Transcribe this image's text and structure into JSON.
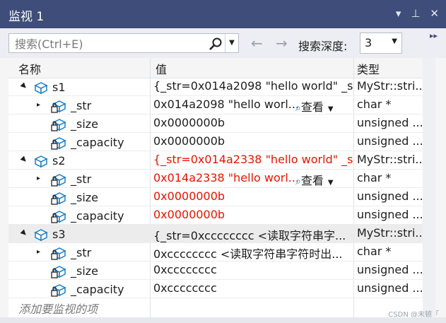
{
  "window": {
    "title": "监视 1",
    "icons": [
      "pin-dropdown-icon",
      "pin-icon",
      "close-icon"
    ]
  },
  "toolbar": {
    "search_placeholder": "搜索(Ctrl+E)",
    "depth_label": "搜索深度:",
    "depth_value": "3"
  },
  "columns": {
    "name": "名称",
    "value": "值",
    "type": "类型"
  },
  "rows": [
    {
      "name": "s1",
      "value": "{_str=0x014a2098 \"hello world\" _s...",
      "type": "MyStr::stri...",
      "level": 0,
      "expander": "▲",
      "changed": false,
      "viewer": false
    },
    {
      "name": "_str",
      "value": "0x014a2098 \"hello worl...",
      "type": "char *",
      "level": 1,
      "expander": "▷",
      "changed": false,
      "viewer": true
    },
    {
      "name": "_size",
      "value": "0x0000000b",
      "type": "unsigned ...",
      "level": 1,
      "expander": "",
      "changed": false,
      "viewer": false
    },
    {
      "name": "_capacity",
      "value": "0x0000000b",
      "type": "unsigned ...",
      "level": 1,
      "expander": "",
      "changed": false,
      "viewer": false
    },
    {
      "name": "s2",
      "value": "{_str=0x014a2338 \"hello world\" _s...",
      "type": "MyStr::stri...",
      "level": 0,
      "expander": "▲",
      "changed": true,
      "viewer": false
    },
    {
      "name": "_str",
      "value": "0x014a2338 \"hello worl...",
      "type": "char *",
      "level": 1,
      "expander": "▷",
      "changed": true,
      "viewer": true
    },
    {
      "name": "_size",
      "value": "0x0000000b",
      "type": "unsigned ...",
      "level": 1,
      "expander": "",
      "changed": true,
      "viewer": false
    },
    {
      "name": "_capacity",
      "value": "0x0000000b",
      "type": "unsigned ...",
      "level": 1,
      "expander": "",
      "changed": true,
      "viewer": false
    },
    {
      "name": "s3",
      "value": "{_str=0xcccccccc <读取字符串字...",
      "type": "MyStr::stri...",
      "level": 0,
      "expander": "▲",
      "changed": false,
      "viewer": false,
      "selected": true
    },
    {
      "name": "_str",
      "value": "0xcccccccc <读取字符串字符时出...",
      "type": "char *",
      "level": 1,
      "expander": "▷",
      "changed": false,
      "viewer": false
    },
    {
      "name": "_size",
      "value": "0xcccccccc",
      "type": "unsigned ...",
      "level": 1,
      "expander": "",
      "changed": false,
      "viewer": false
    },
    {
      "name": "_capacity",
      "value": "0xcccccccc",
      "type": "unsigned ...",
      "level": 1,
      "expander": "",
      "changed": false,
      "viewer": false
    }
  ],
  "viewer_label": "查看",
  "add_hint": "添加要监视的项",
  "watermark": "CSDN @末顿「",
  "colors": {
    "titlebar": "#3e4d7a",
    "changed_value": "#e51400",
    "object_icon": "#1c7ec9"
  }
}
